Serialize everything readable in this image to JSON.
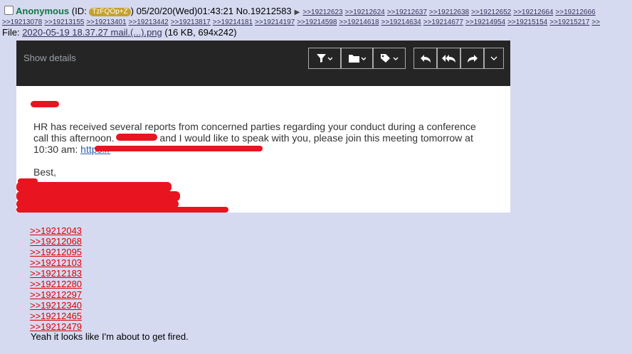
{
  "post": {
    "name": "Anonymous",
    "id_label_open": "(ID:",
    "id": "TzFQOp+Z",
    "id_label_close": ")",
    "datetime": "05/20/20(Wed)01:43:21",
    "number": "No.19212583",
    "replies_row1": [
      ">>19212623",
      ">>19212624",
      ">>19212637",
      ">>19212638",
      ">>19212652",
      ">>19212664",
      ">>19212666"
    ],
    "replies_row2": [
      ">>19213078",
      ">>19213155",
      ">>19213401",
      ">>19213442",
      ">>19213817",
      ">>19214181",
      ">>19214197",
      ">>19214598",
      ">>19214618",
      ">>19214634",
      ">>19214677",
      ">>19214954",
      ">>19215154",
      ">>19215217",
      ">>"
    ],
    "file_label": "File:",
    "file_name": "2020-05-19 18.37.27 mail.(...).png",
    "file_meta": "(16 KB, 694x242)",
    "quote_links": [
      ">>19212043",
      ">>19212068",
      ">>19212095",
      ">>19212103",
      ">>19212183",
      ">>19212280",
      ">>19212297",
      ">>19212340",
      ">>19212465",
      ">>19212479"
    ],
    "message": "Yeah it looks like I'm about to get fired."
  },
  "email": {
    "show_details": "Show details",
    "body_line1": "HR has received several reports from concerned parties regarding your conduct during a conference",
    "body_line2a": "call this afternoon.",
    "body_line2b": "and I would like to speak with you, please join this meeting tomorrow at",
    "body_line3": "10:30 am:",
    "body_link": "https://",
    "signoff": "Best,",
    "toolbar_icons": [
      "filter-icon",
      "folder-icon",
      "tag-icon",
      "reply-icon",
      "reply-all-icon",
      "forward-icon",
      "more-chevron-icon"
    ]
  },
  "colors": {
    "page_bg": "#d6daf0",
    "name": "#117743",
    "quote_link": "#dd0000",
    "redaction": "#e8141f",
    "toolbar_bg": "#252526"
  }
}
